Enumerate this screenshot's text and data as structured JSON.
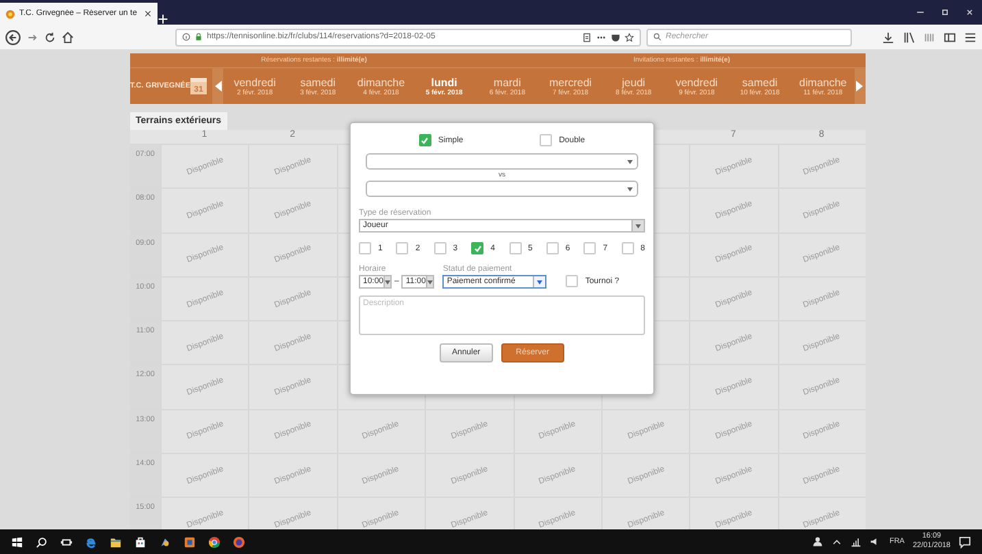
{
  "browser": {
    "tab_title": "T.C. Grivegnée – Réserver un te",
    "url": "https://tennisonline.biz/fr/clubs/114/reservations?d=2018-02-05",
    "search_placeholder": "Rechercher"
  },
  "header": {
    "reservations": "Réservations restantes : **illimité(e)**",
    "invitations": "Invitations restantes : **illimité(e)**",
    "club_name": "T.C. GRIVEGNÉE",
    "calendar_day": "31"
  },
  "days": [
    {
      "name": "vendredi",
      "date": "2 févr. 2018",
      "selected": false
    },
    {
      "name": "samedi",
      "date": "3 févr. 2018",
      "selected": false
    },
    {
      "name": "dimanche",
      "date": "4 févr. 2018",
      "selected": false
    },
    {
      "name": "lundi",
      "date": "5 févr. 2018",
      "selected": true
    },
    {
      "name": "mardi",
      "date": "6 févr. 2018",
      "selected": false
    },
    {
      "name": "mercredi",
      "date": "7 févr. 2018",
      "selected": false
    },
    {
      "name": "jeudi",
      "date": "8 févr. 2018",
      "selected": false
    },
    {
      "name": "vendredi",
      "date": "9 févr. 2018",
      "selected": false
    },
    {
      "name": "samedi",
      "date": "10 févr. 2018",
      "selected": false
    },
    {
      "name": "dimanche",
      "date": "11 févr. 2018",
      "selected": false
    }
  ],
  "tabs": [
    {
      "label": "Terrains extérieurs",
      "selected": true
    }
  ],
  "grid": {
    "columns": [
      {
        "label": "1"
      },
      {
        "label": "2"
      },
      {},
      {},
      {},
      {},
      {
        "label": "7"
      },
      {
        "label": "8"
      }
    ],
    "rows": [
      {
        "time": "07:00",
        "cells": [
          {
            "label": "Disponible"
          },
          {
            "label": "Disponible"
          },
          {},
          {},
          {},
          {},
          {
            "label": "Disponible"
          },
          {
            "label": "Disponible"
          }
        ]
      },
      {
        "time": "08:00",
        "cells": [
          {
            "label": "Disponible"
          },
          {
            "label": "Disponible"
          },
          {},
          {},
          {},
          {},
          {
            "label": "Disponible"
          },
          {
            "label": "Disponible"
          }
        ]
      },
      {
        "time": "09:00",
        "cells": [
          {
            "label": "Disponible"
          },
          {
            "label": "Disponible"
          },
          {},
          {},
          {},
          {},
          {
            "label": "Disponible"
          },
          {
            "label": "Disponible"
          }
        ]
      },
      {
        "time": "10:00",
        "cells": [
          {
            "label": "Disponible"
          },
          {
            "label": "Disponible"
          },
          {},
          {},
          {},
          {},
          {
            "label": "Disponible"
          },
          {
            "label": "Disponible"
          }
        ]
      },
      {
        "time": "11:00",
        "cells": [
          {
            "label": "Disponible"
          },
          {
            "label": "Disponible"
          },
          {},
          {},
          {},
          {},
          {
            "label": "Disponible"
          },
          {
            "label": "Disponible"
          }
        ]
      },
      {
        "time": "12:00",
        "cells": [
          {
            "label": "Disponible"
          },
          {
            "label": "Disponible"
          },
          {},
          {},
          {},
          {},
          {
            "label": "Disponible"
          },
          {
            "label": "Disponible"
          }
        ]
      },
      {
        "time": "13:00",
        "cells": [
          {
            "label": "Disponible"
          },
          {
            "label": "Disponible"
          },
          {
            "label": "Disponible"
          },
          {
            "label": "Disponible"
          },
          {
            "label": "Disponible"
          },
          {
            "label": "Disponible"
          },
          {
            "label": "Disponible"
          },
          {
            "label": "Disponible"
          }
        ]
      },
      {
        "time": "14:00",
        "cells": [
          {
            "label": "Disponible"
          },
          {
            "label": "Disponible"
          },
          {
            "label": "Disponible"
          },
          {
            "label": "Disponible"
          },
          {
            "label": "Disponible"
          },
          {
            "label": "Disponible"
          },
          {
            "label": "Disponible"
          },
          {
            "label": "Disponible"
          }
        ]
      },
      {
        "time": "15:00",
        "cells": [
          {
            "label": "Disponible"
          },
          {
            "label": "Disponible"
          },
          {
            "label": "Disponible"
          },
          {
            "label": "Disponible"
          },
          {
            "label": "Disponible"
          },
          {
            "label": "Disponible"
          },
          {
            "label": "Disponible"
          },
          {
            "label": "Disponible"
          }
        ]
      }
    ]
  },
  "modal": {
    "match_types": [
      {
        "label": "Simple",
        "checked": true
      },
      {
        "label": "Double",
        "checked": false
      }
    ],
    "vs_label": "vs",
    "type_label": "Type de réservation",
    "type_value": "Joueur",
    "courts": [
      {
        "label": "1",
        "checked": false
      },
      {
        "label": "2",
        "checked": false
      },
      {
        "label": "3",
        "checked": false
      },
      {
        "label": "4",
        "checked": true
      },
      {
        "label": "5",
        "checked": false
      },
      {
        "label": "6",
        "checked": false
      },
      {
        "label": "7",
        "checked": false
      },
      {
        "label": "8",
        "checked": false
      }
    ],
    "time_label": "Horaire",
    "start": "10:00",
    "dash": "–",
    "end": "11:00",
    "payment_label": "Statut de paiement",
    "payment_value": "Paiement confirmé",
    "tournament": {
      "label": "Tournoi ?",
      "checked": false
    },
    "description_placeholder": "Description",
    "cancel": "Annuler",
    "submit": "Réserver"
  },
  "taskbar": {
    "language": "FRA",
    "time": "16:09",
    "date": "22/01/2018"
  }
}
